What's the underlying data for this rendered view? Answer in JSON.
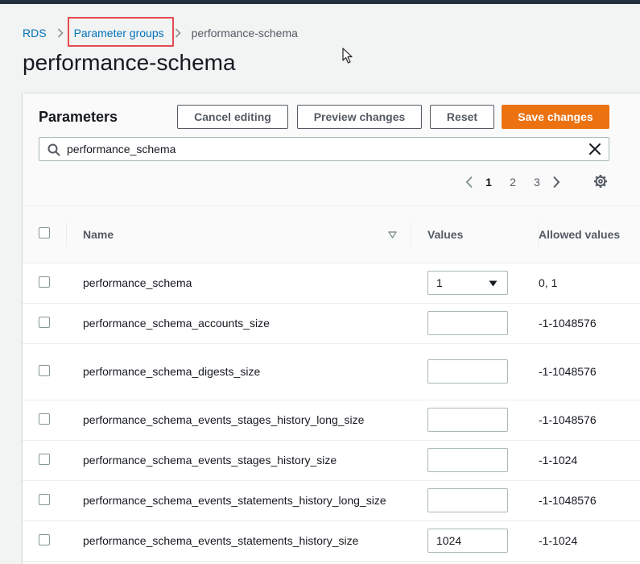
{
  "breadcrumb": {
    "root": "RDS",
    "parent": "Parameter groups",
    "current": "performance-schema"
  },
  "page": {
    "title": "performance-schema"
  },
  "parameters": {
    "title": "Parameters",
    "buttons": {
      "cancel": "Cancel editing",
      "preview": "Preview changes",
      "reset": "Reset",
      "save": "Save changes"
    },
    "search": {
      "value": "performance_schema"
    },
    "pagination": {
      "pages": [
        "1",
        "2",
        "3"
      ],
      "current": "1"
    },
    "columns": {
      "name": "Name",
      "values": "Values",
      "allowed": "Allowed values"
    },
    "rows": [
      {
        "name": "performance_schema",
        "value": "1",
        "type": "select",
        "allowed": "0, 1"
      },
      {
        "name": "performance_schema_accounts_size",
        "value": "",
        "type": "input",
        "allowed": "-1-1048576"
      },
      {
        "name": "performance_schema_digests_size",
        "value": "",
        "type": "input",
        "allowed": "-1-1048576"
      },
      {
        "name": "performance_schema_events_stages_history_long_size",
        "value": "",
        "type": "input",
        "allowed": "-1-1048576"
      },
      {
        "name": "performance_schema_events_stages_history_size",
        "value": "",
        "type": "input",
        "allowed": "-1-1024"
      },
      {
        "name": "performance_schema_events_statements_history_long_size",
        "value": "",
        "type": "input",
        "allowed": "-1-1048576"
      },
      {
        "name": "performance_schema_events_statements_history_size",
        "value": "1024",
        "type": "input",
        "allowed": "-1-1024"
      }
    ]
  },
  "colors": {
    "accent": "#ec7211",
    "link": "#0073bb",
    "highlight": "#e4494f",
    "topbar": "#232f3e"
  }
}
